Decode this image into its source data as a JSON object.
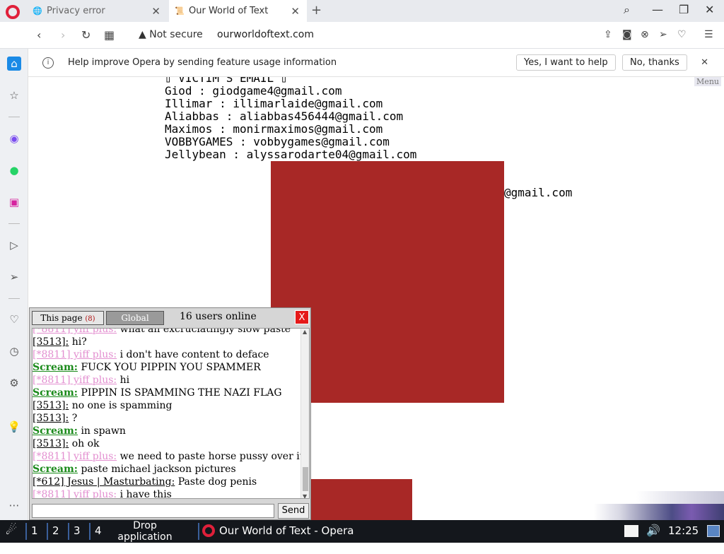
{
  "browser": {
    "tabs": [
      {
        "label": "Privacy error",
        "icon": "privacy-error-icon"
      },
      {
        "label": "Our World of Text",
        "icon": "site-favicon"
      }
    ],
    "new_tab_symbol": "+",
    "security_label": "Not secure",
    "url": "ourworldoftext.com"
  },
  "infobar": {
    "message": "Help improve Opera by sending feature usage information",
    "accept_label": "Yes, I want to help",
    "decline_label": "No, thanks"
  },
  "page": {
    "menu_label": "Menu",
    "text_lines": [
      "▯ VICTIM'S EMAIL ▯",
      "Giod : giodgame4@gmail.com",
      "Illimar : illimarlaide@gmail.com",
      "Aliabbas : aliabbas456444@gmail.com",
      "Maximos : monirmaximos@gmail.com",
      "VOBBYGAMES : vobbygames@gmail.com",
      "Jellybean : alyssarodarte04@gmail.com"
    ],
    "partial_email": "@gmail.com",
    "block_color": "#a82826"
  },
  "chat": {
    "tab_this_page": "This page",
    "tab_this_page_count": "(8)",
    "tab_global": "Global",
    "online": "16 users online",
    "close_label": "X",
    "send_label": "Send",
    "messages": [
      {
        "nick": "[*8811] yiff plus:",
        "style": "pink",
        "text": "what an excruciatingly slow paste"
      },
      {
        "nick": "[3513]:",
        "style": "plain",
        "text": "hi?"
      },
      {
        "nick": "[*8811] yiff plus:",
        "style": "pink",
        "text": "i don't have content to deface"
      },
      {
        "nick": "Scream:",
        "style": "green",
        "text": "FUCK YOU PIPPIN YOU SPAMMER"
      },
      {
        "nick": "[*8811] yiff plus:",
        "style": "pink",
        "text": "hi"
      },
      {
        "nick": "Scream:",
        "style": "green",
        "text": "PIPPIN IS SPAMMING THE NAZI FLAG"
      },
      {
        "nick": "[3513]:",
        "style": "plain",
        "text": "no one is spamming"
      },
      {
        "nick": "[3513]:",
        "style": "plain",
        "text": "?"
      },
      {
        "nick": "Scream:",
        "style": "green",
        "text": "in spawn"
      },
      {
        "nick": "[3513]:",
        "style": "plain",
        "text": "oh ok"
      },
      {
        "nick": "[*8811] yiff plus:",
        "style": "pink",
        "text": "we need to paste horse pussy over it"
      },
      {
        "nick": "Scream:",
        "style": "green",
        "text": "paste michael jackson pictures"
      },
      {
        "nick": "[*612] Jesus | Masturbating:",
        "style": "plain",
        "text": "Paste dog penis"
      },
      {
        "nick": "[*8811] yiff plus:",
        "style": "pink",
        "text": "i have this"
      }
    ]
  },
  "taskbar": {
    "workspaces": [
      "1",
      "2",
      "3",
      "4"
    ],
    "drop_hint": "Drop application icons here",
    "app_label": "Our World of Text - Opera",
    "clock": "12:25"
  }
}
